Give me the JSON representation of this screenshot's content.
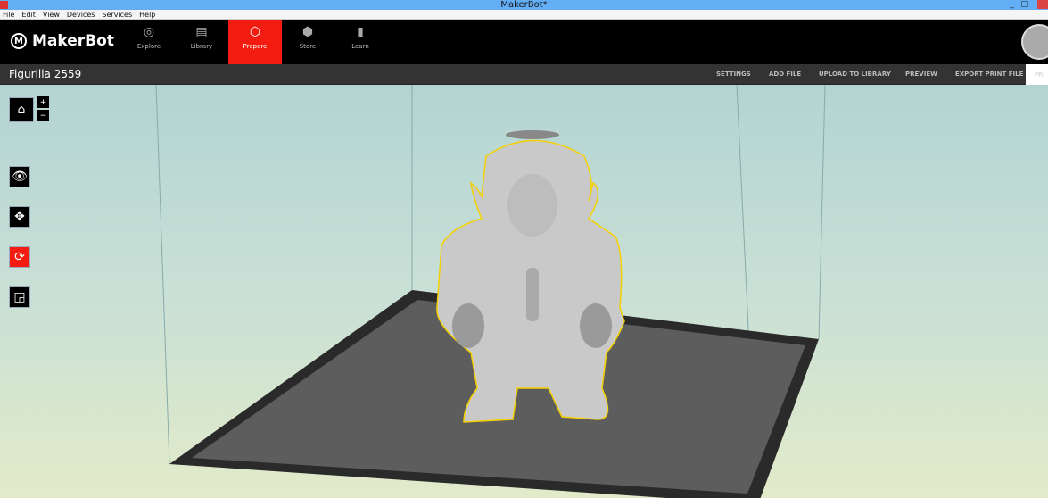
{
  "window": {
    "title": "MakerBot*"
  },
  "menu": [
    "File",
    "Edit",
    "View",
    "Devices",
    "Services",
    "Help"
  ],
  "brand": "MakerBot",
  "nav": [
    {
      "label": "Explore",
      "icon": "compass-icon"
    },
    {
      "label": "Library",
      "icon": "library-icon"
    },
    {
      "label": "Prepare",
      "icon": "prepare-icon",
      "active": true
    },
    {
      "label": "Store",
      "icon": "box-icon"
    },
    {
      "label": "Learn",
      "icon": "book-icon"
    }
  ],
  "project": {
    "title": "Figurilla 2559"
  },
  "actions": {
    "settings": "SETTINGS",
    "add_file": "ADD FILE",
    "upload": "UPLOAD TO LIBRARY",
    "preview": "PREVIEW",
    "export": "EXPORT PRINT FILE",
    "print": "PRI"
  },
  "tools": {
    "home": "home-icon",
    "zoom_in": "+",
    "zoom_out": "−",
    "view": "eye-icon",
    "move": "move-icon",
    "rotate": "rotate-icon",
    "scale": "scale-icon"
  },
  "colors": {
    "accent": "#f41c11",
    "selection_outline": "#f5d000"
  }
}
